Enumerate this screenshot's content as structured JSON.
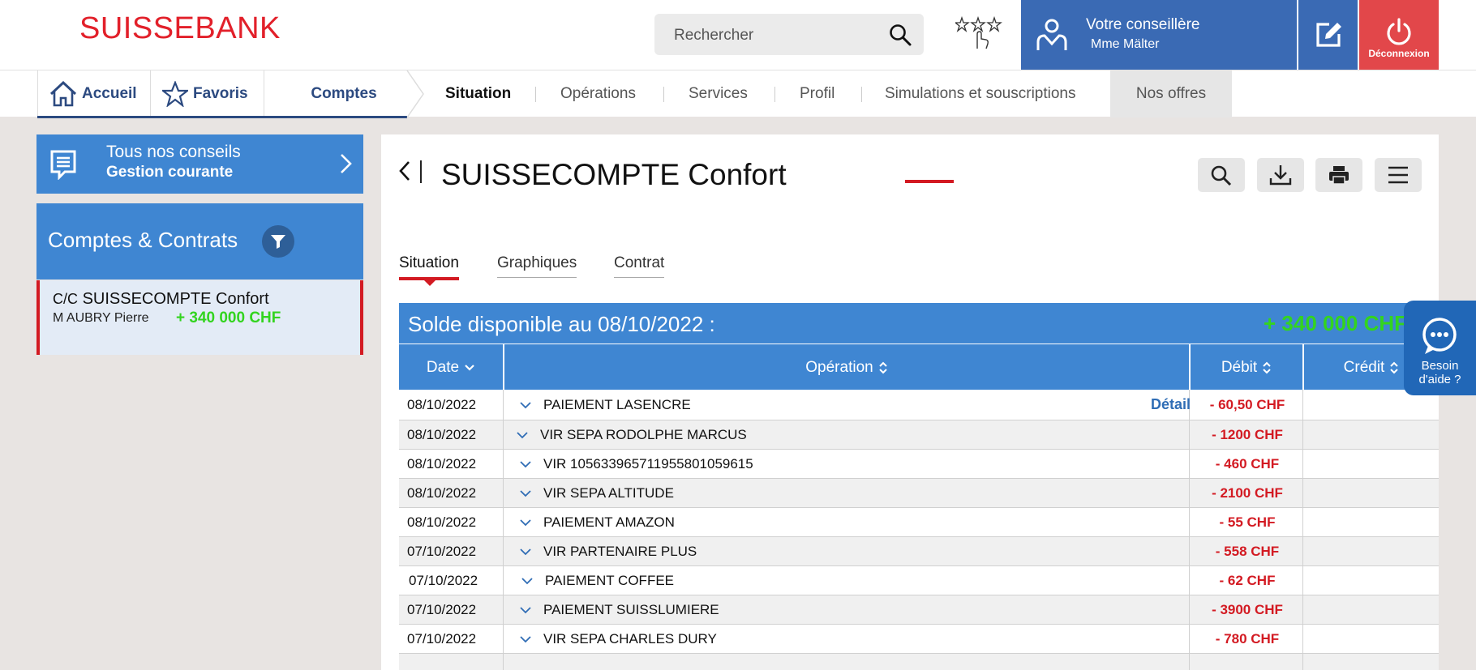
{
  "header": {
    "logo": "SUISSEBANK",
    "search_placeholder": "Rechercher",
    "advisor_title": "Votre conseillère",
    "advisor_name": "Mme Mälter",
    "logout_label": "Déconnexion"
  },
  "nav": {
    "home": "Accueil",
    "favorites": "Favoris",
    "accounts": "Comptes",
    "sub": [
      "Situation",
      "Opérations",
      "Services",
      "Profil",
      "Simulations et souscriptions"
    ],
    "offers": "Nos offres"
  },
  "sidebar": {
    "advice_title": "Tous nos conseils",
    "advice_subtitle": "Gestion courante",
    "accounts_title": "Comptes & Contrats",
    "account": {
      "type": "C/C",
      "name": "SUISSECOMPTE Confort",
      "owner": "M AUBRY Pierre",
      "balance": "+ 340 000 CHF"
    }
  },
  "main": {
    "title": "SUISSECOMPTE Confort",
    "tabs": [
      "Situation",
      "Graphiques",
      "Contrat"
    ],
    "balance_label": "Solde disponible au 08/10/2022 :",
    "balance_amount": "+ 340 000 CHF",
    "columns": [
      "Date",
      "Opération",
      "Débit",
      "Crédit"
    ],
    "detail_label": "Détail",
    "rows": [
      {
        "date": "08/10/2022",
        "operation": "PAIEMENT LASENCRE",
        "debit": "- 60,50 CHF"
      },
      {
        "date": "08/10/2022",
        "operation": "VIR SEPA RODOLPHE MARCUS",
        "debit": "- 1200 CHF"
      },
      {
        "date": "08/10/2022",
        "operation": "VIR 10563396571195580105961​5",
        "debit": "- 460 CHF"
      },
      {
        "date": "08/10/2022",
        "operation": "VIR SEPA ALTITUDE",
        "debit": "- 2100 CHF"
      },
      {
        "date": "08/10/2022",
        "operation": "PAIEMENT AMAZON",
        "debit": "- 55 CHF"
      },
      {
        "date": "07/10/2022",
        "operation": "VIR PARTENAIRE PLUS",
        "debit": "- 558 CHF"
      },
      {
        "date": "07/10/2022",
        "operation": "PAIEMENT COFFEE",
        "debit": "- 62 CHF"
      },
      {
        "date": "07/10/2022",
        "operation": "PAIEMENT SUISSLUMIERE",
        "debit": "- 3900 CHF"
      },
      {
        "date": "07/10/2022",
        "operation": "VIR SEPA CHARLES DURY",
        "debit": "- 780 CHF"
      }
    ]
  },
  "help": {
    "label_line1": "Besoin",
    "label_line2": "d'aide ?"
  },
  "colors": {
    "brand_red": "#e2202a",
    "primary_blue": "#3f86d2",
    "advisor_blue": "#3a6ab4",
    "positive_green": "#33d41f",
    "debit_red": "#d31a22"
  }
}
